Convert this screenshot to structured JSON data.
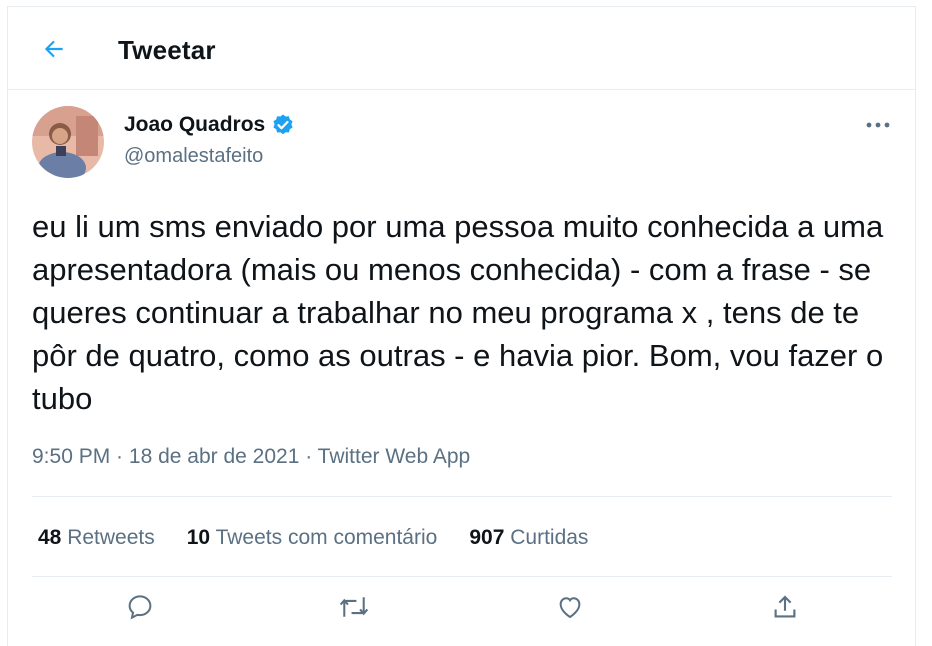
{
  "header": {
    "title": "Tweetar",
    "back_icon": "arrow-left-icon"
  },
  "author": {
    "name": "Joao Quadros",
    "handle": "@omalestafeito",
    "verified": true
  },
  "tweet": {
    "text": "eu li um sms enviado por uma pessoa muito conhecida a uma apresentadora (mais ou menos conhecida) - com a frase - se queres continuar a trabalhar no meu programa x , tens de te pôr de quatro, como as outras - e havia pior. Bom, vou fazer o tubo",
    "time": "9:50 PM",
    "separator": " · ",
    "date": "18 de abr de 2021",
    "source": "Twitter Web App"
  },
  "stats": {
    "retweets_count": "48",
    "retweets_label": "Retweets",
    "quotes_count": "10",
    "quotes_label": "Tweets com comentário",
    "likes_count": "907",
    "likes_label": "Curtidas"
  },
  "actions": [
    "reply-icon",
    "retweet-icon",
    "like-icon",
    "share-icon"
  ],
  "colors": {
    "accent": "#1da1f2",
    "secondary_text": "#5b7083",
    "border": "#e6ecf0"
  }
}
